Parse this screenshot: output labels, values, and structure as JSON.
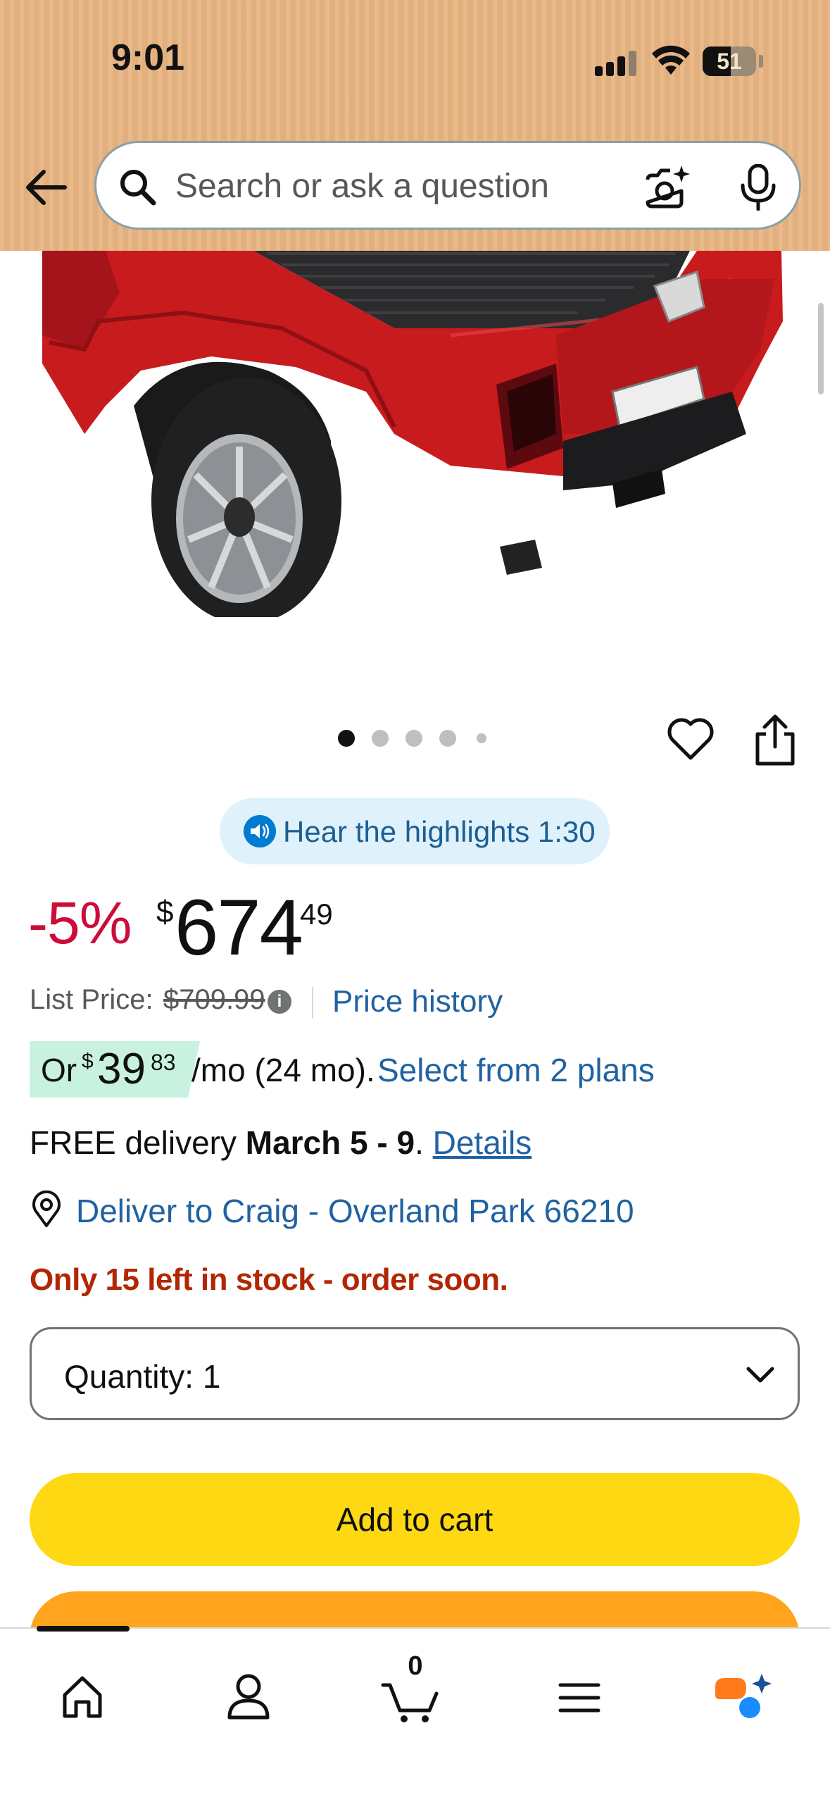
{
  "status_bar": {
    "time": "9:01",
    "battery": "51"
  },
  "search": {
    "placeholder": "Search or ask a question"
  },
  "image_carousel": {
    "page_count": 5,
    "active_index": 0
  },
  "highlights": {
    "label": "Hear the highlights 1:30"
  },
  "price": {
    "discount": "-5%",
    "currency_symbol": "$",
    "whole": "674",
    "fraction": "49",
    "list_price_label": "List Price:",
    "list_price_value": "$709.99",
    "info_glyph": "i",
    "price_history_link": "Price history"
  },
  "installment": {
    "prefix": "Or",
    "currency_symbol": "$",
    "whole": "39",
    "fraction": "83",
    "term": "/mo (24 mo).",
    "plans_link": "Select from 2 plans"
  },
  "delivery": {
    "prefix": "FREE delivery",
    "dates": "March 5 - 9",
    "separator": ". ",
    "details_link": "Details"
  },
  "location": {
    "label": "Deliver to Craig - Overland Park 66210"
  },
  "stock": {
    "message": "Only 15 left in stock - order soon."
  },
  "quantity": {
    "label": "Quantity:",
    "value": "1"
  },
  "actions": {
    "add_to_cart": "Add to cart",
    "buy_now": ""
  },
  "bottom_nav": {
    "cart_count": "0"
  },
  "colors": {
    "header_bg": "#e9b582",
    "discount_red": "#cc0c39",
    "link_blue": "#2162a1",
    "stock_red": "#b12704",
    "add_to_cart_yellow": "#ffd814",
    "buy_now_orange": "#ffa41c",
    "installment_green": "#c9f1df"
  },
  "icons": [
    "back-arrow-icon",
    "search-icon",
    "camera-icon",
    "mic-icon",
    "heart-icon",
    "share-icon",
    "speaker-icon",
    "info-icon",
    "location-pin-icon",
    "chevron-down-icon",
    "home-icon",
    "account-icon",
    "cart-icon",
    "menu-icon",
    "rufus-ai-icon"
  ]
}
